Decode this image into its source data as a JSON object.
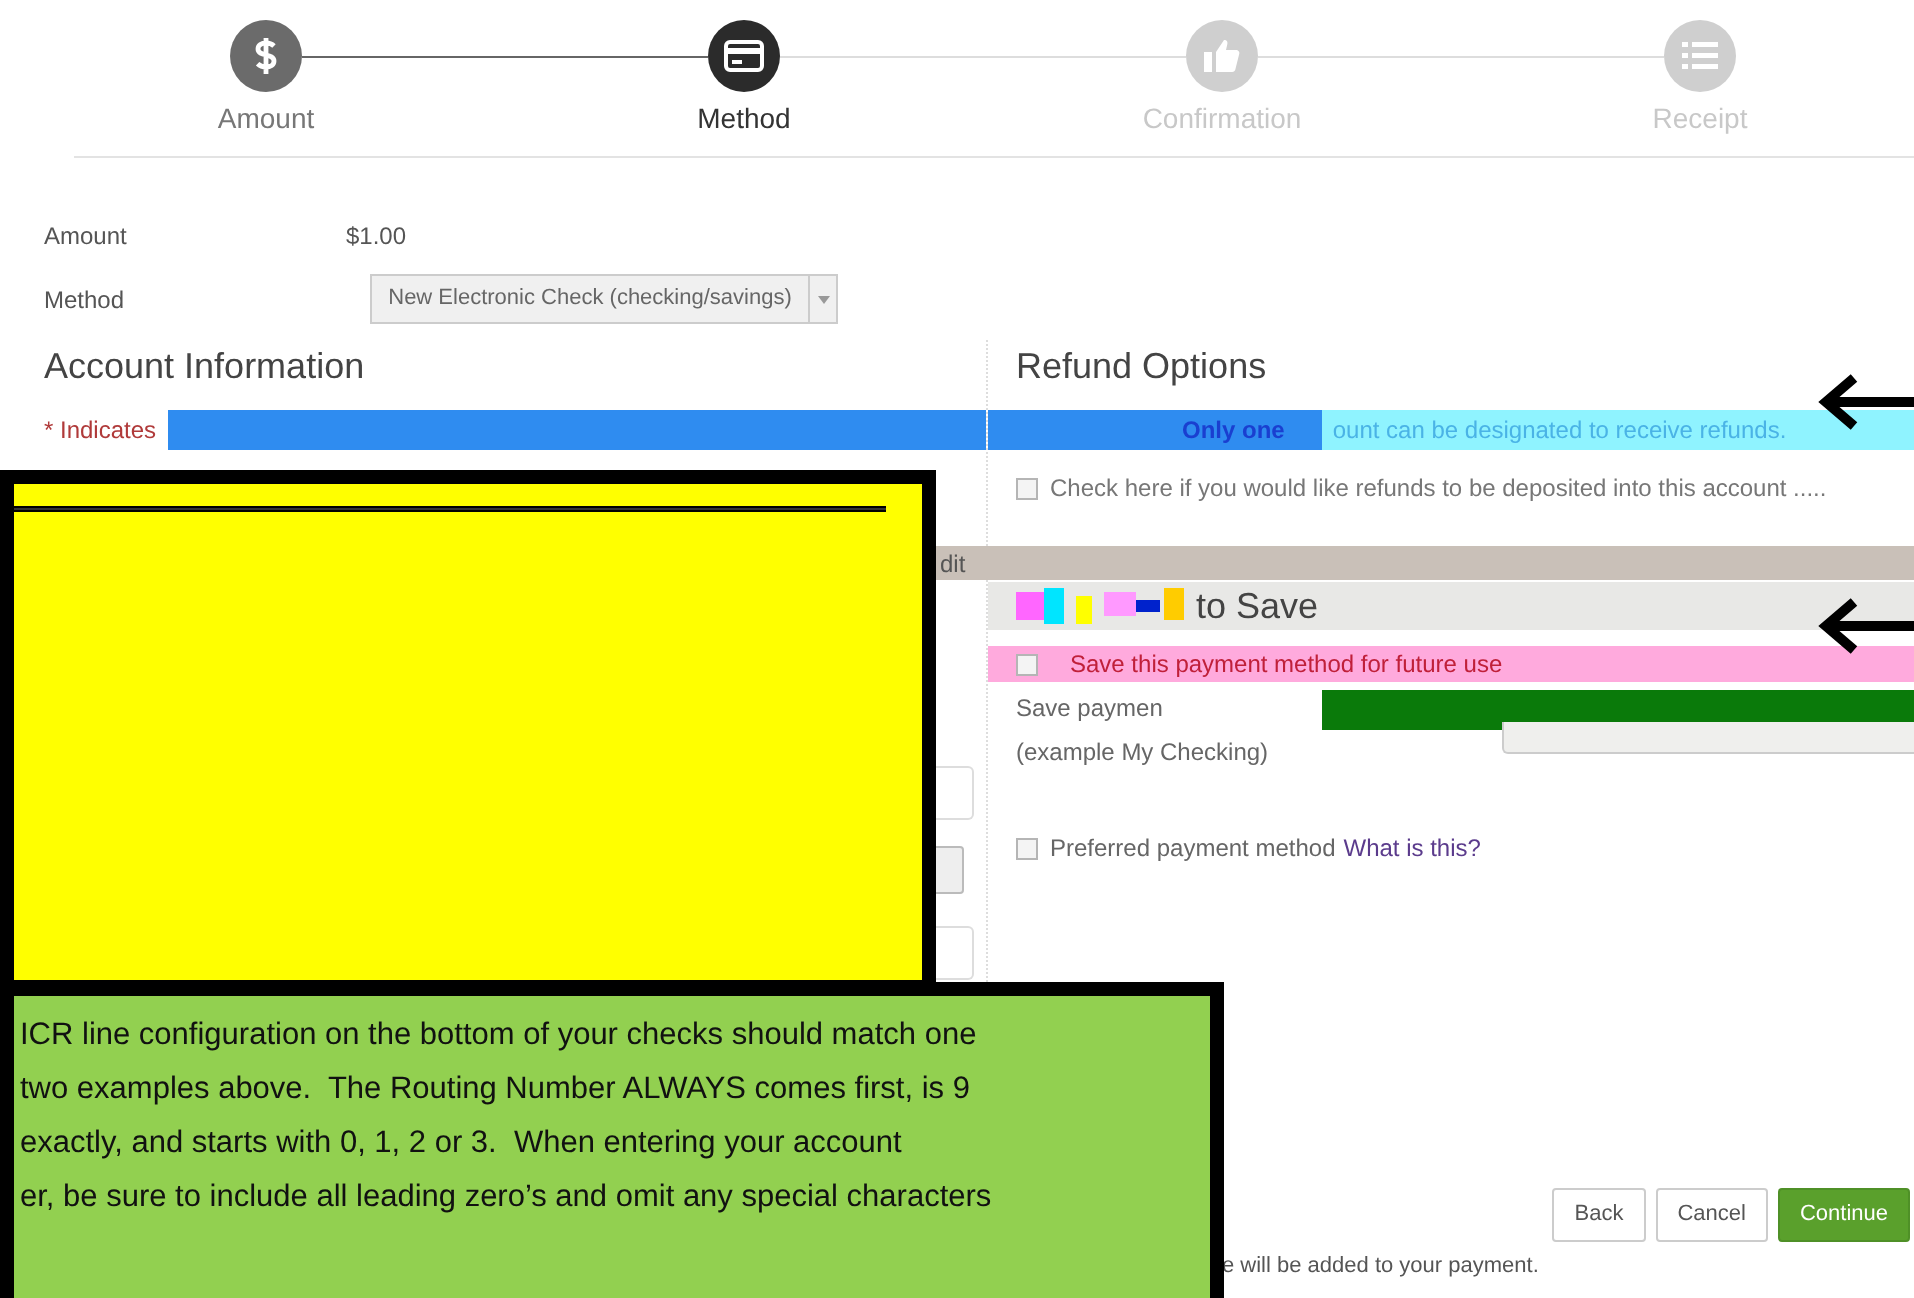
{
  "steps": [
    {
      "label": "Amount",
      "selected": false,
      "completed": true
    },
    {
      "label": "Method",
      "selected": true,
      "completed": false
    },
    {
      "label": "Confirmation",
      "selected": false,
      "completed": false
    },
    {
      "label": "Receipt",
      "selected": false,
      "completed": false
    }
  ],
  "summary": [
    {
      "label": "Amount",
      "value": "$1.00"
    }
  ],
  "method": {
    "label": "Method",
    "value": "New Electronic Check (checking/savings)"
  },
  "account": {
    "heading": "Account Information",
    "required_note": "* Indicates"
  },
  "refund": {
    "heading": "Refund Options",
    "notice_bold": "Only one",
    "notice_rest": "ount can be designated to receive refunds.",
    "checkbox": {
      "label": "Check here if you would like refunds to be deposited into this account .....",
      "checked": false
    }
  },
  "edit_fragment": "dit",
  "save": {
    "heading": "to Save",
    "checkbox": {
      "label": "Save this payment method for future use",
      "checked": false
    },
    "nickname_label": "Save paymen",
    "nickname_hint": "(example My Checking)",
    "preferred": {
      "label": "Preferred payment method",
      "link": "What is this?",
      "checked": false
    }
  },
  "annotation": {
    "lines": [
      "ICR line configuration on the bottom of your checks should match one",
      "two examples above.  The Routing Number ALWAYS comes first, is 9",
      "exactly, and starts with 0, 1, 2 or 3.  When entering your account",
      "er, be sure to include all leading zero’s and omit any special characters"
    ]
  },
  "buttons": [
    {
      "label": "Back",
      "kind": "secondary"
    },
    {
      "label": "Cancel",
      "kind": "secondary"
    },
    {
      "label": "Continue",
      "kind": "primary"
    }
  ],
  "footer_note": "e will be added to your payment."
}
